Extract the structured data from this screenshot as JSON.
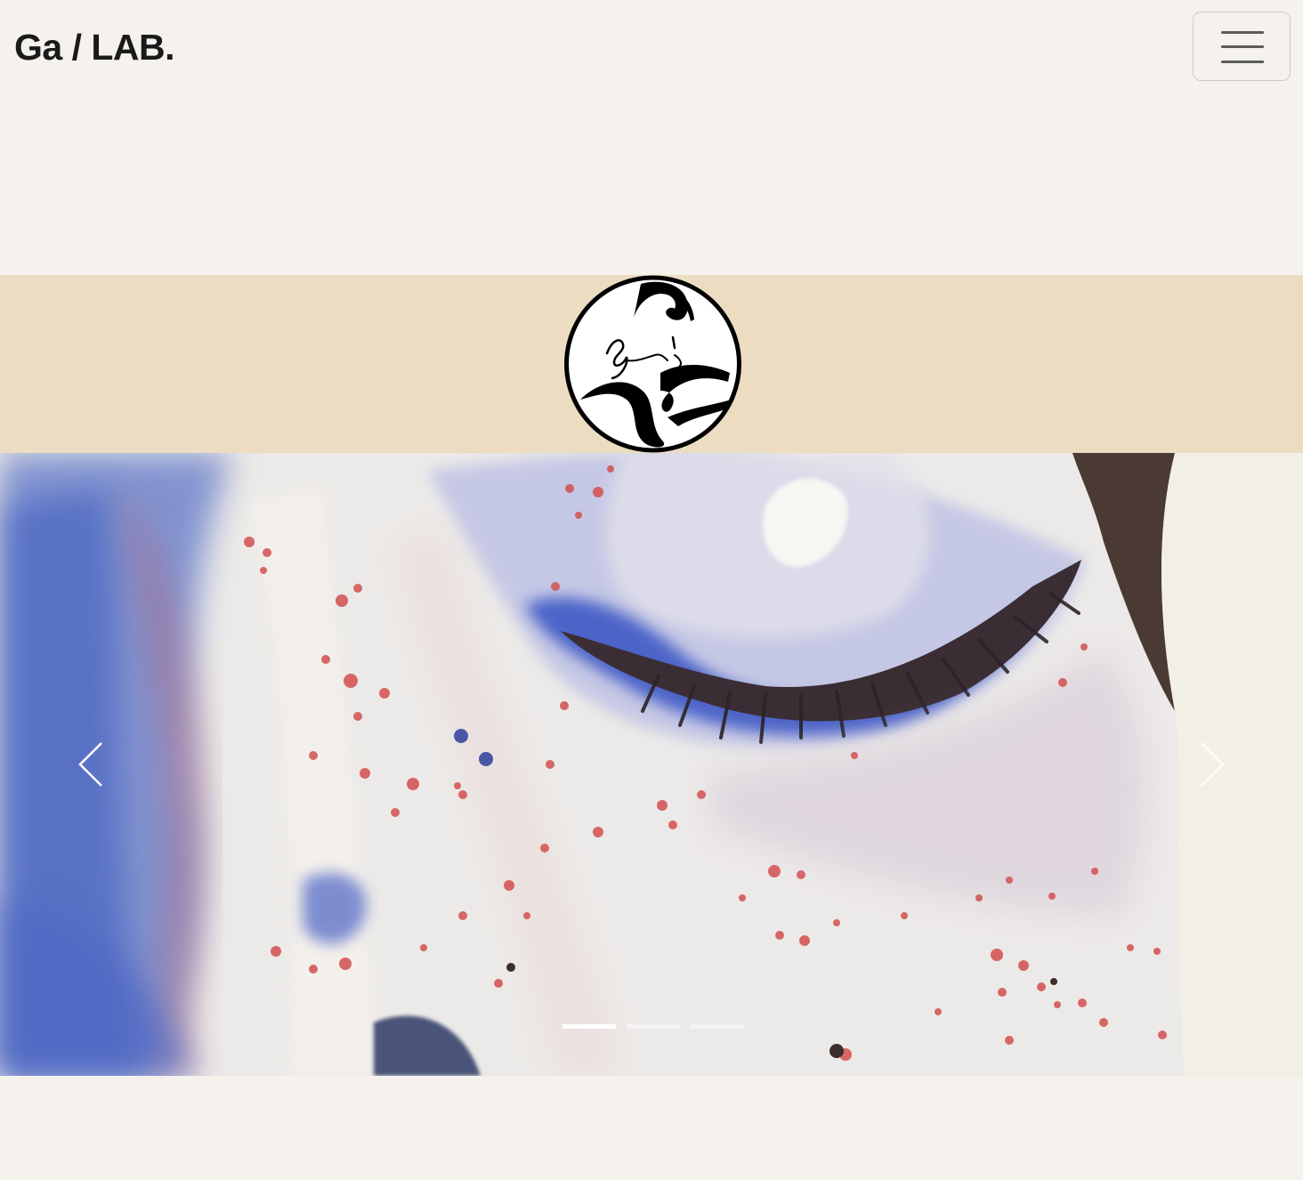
{
  "navbar": {
    "brand": "Ga / LAB.",
    "menu_icon": "hamburger-menu-icon"
  },
  "banner": {
    "background_color": "#ecdcc2",
    "logo": "circular-ink-logo"
  },
  "carousel": {
    "image": "watercolor-closed-eye-painting",
    "prev_icon": "chevron-left-icon",
    "next_icon": "chevron-right-icon",
    "slide_count": 3,
    "active_slide": 1
  },
  "colors": {
    "page_background": "#f5f2ed",
    "brand_text": "#1a1a1a"
  }
}
